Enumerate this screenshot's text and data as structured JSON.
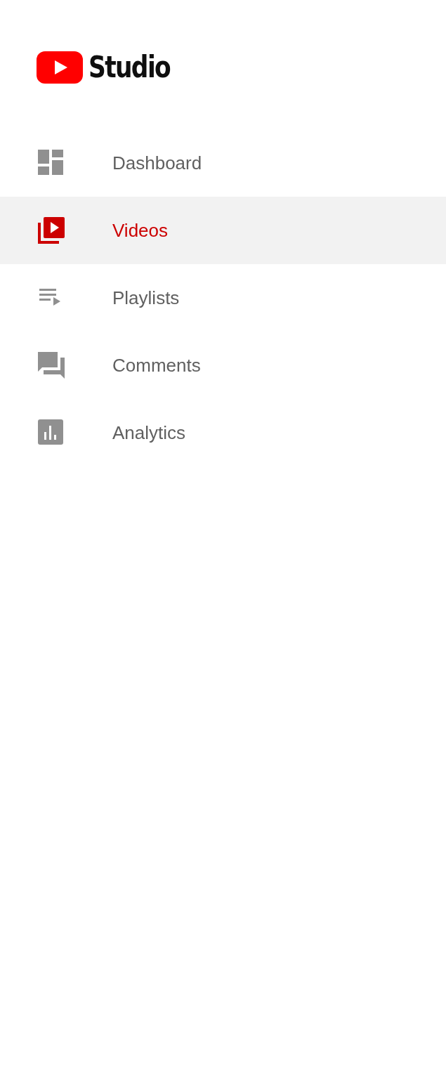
{
  "logo": {
    "text": "Studio"
  },
  "nav_items": [
    {
      "label": "Dashboard",
      "kind": "dashboard",
      "selected": false
    },
    {
      "label": "Videos",
      "kind": "videos",
      "selected": true
    },
    {
      "label": "Playlists",
      "kind": "playlists",
      "selected": false
    },
    {
      "label": "Comments",
      "kind": "comments",
      "selected": false
    },
    {
      "label": "Analytics",
      "kind": "analytics",
      "selected": false
    }
  ]
}
